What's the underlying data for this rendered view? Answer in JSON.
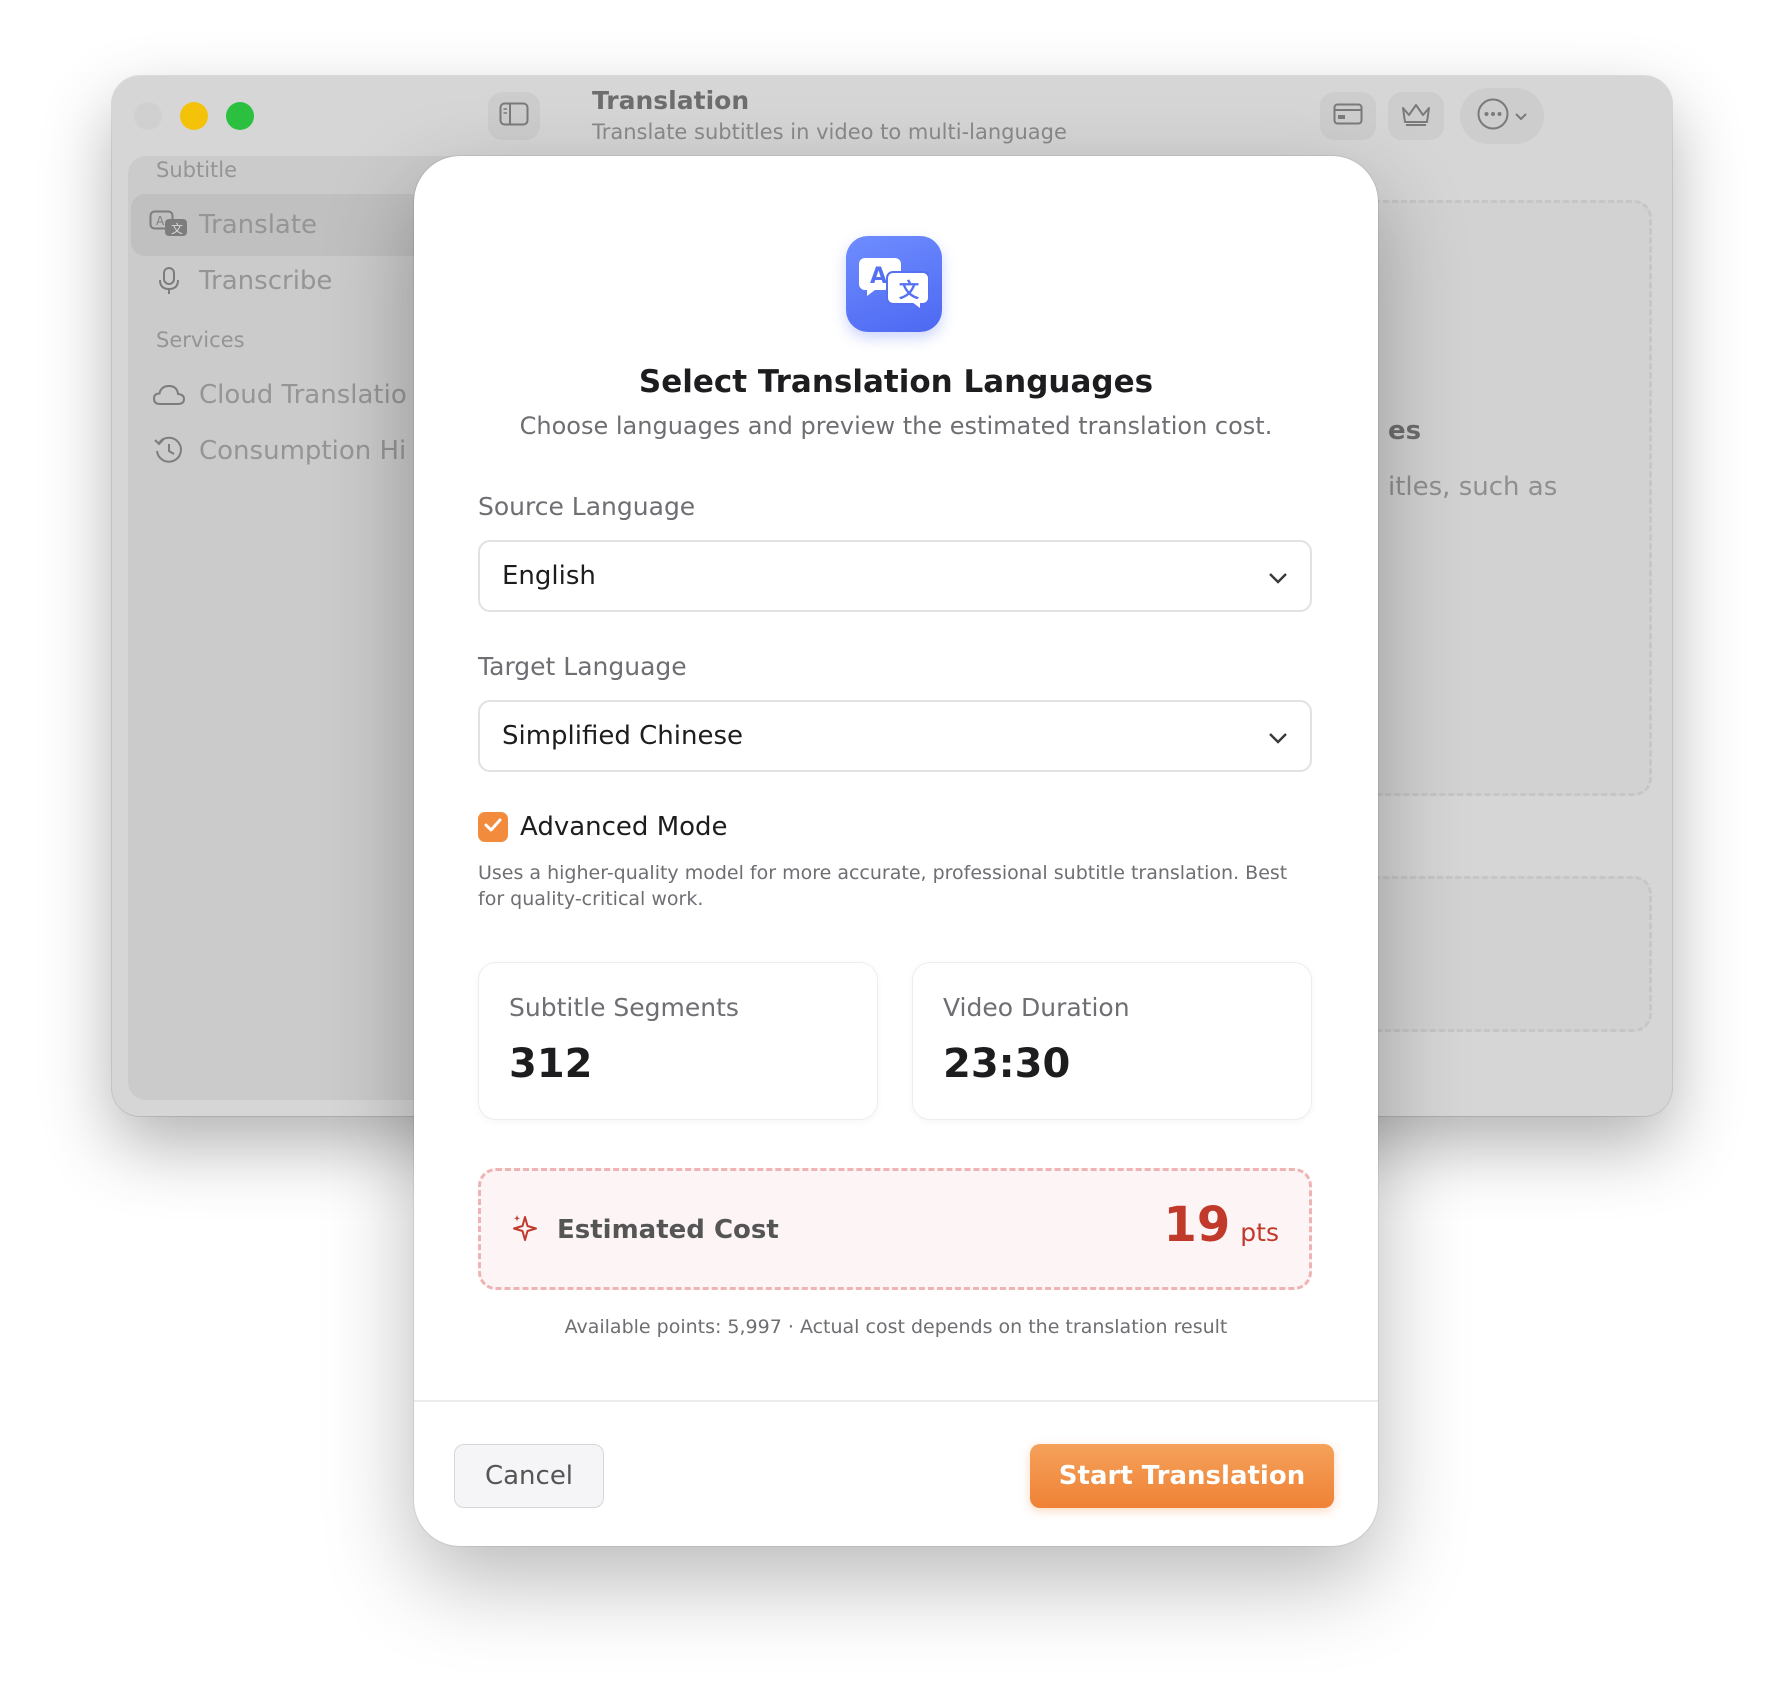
{
  "window": {
    "title": "Translation",
    "subtitle": "Translate subtitles in video to multi-language",
    "toolbar_icons": [
      "sidebar-toggle-icon",
      "card-icon",
      "crown-icon",
      "more-icon",
      "chevron-down-icon"
    ]
  },
  "sidebar": {
    "sections": [
      {
        "title": "Subtitle",
        "items": [
          {
            "label": "Translate",
            "icon": "translate-icon",
            "active": true
          },
          {
            "label": "Transcribe",
            "icon": "microphone-icon",
            "active": false
          }
        ]
      },
      {
        "title": "Services",
        "items": [
          {
            "label": "Cloud Translatio",
            "icon": "cloud-icon",
            "active": false
          },
          {
            "label": "Consumption Hi",
            "icon": "history-icon",
            "active": false
          }
        ]
      }
    ]
  },
  "background": {
    "heading_fragment": "es",
    "text_fragment": "itles, such as"
  },
  "dialog": {
    "icon": "translate-app-icon",
    "title": "Select Translation Languages",
    "subtitle": "Choose languages and preview the estimated translation cost.",
    "source": {
      "label": "Source Language",
      "value": "English"
    },
    "target": {
      "label": "Target Language",
      "value": "Simplified Chinese"
    },
    "advanced": {
      "label": "Advanced Mode",
      "checked": true,
      "description": "Uses a higher-quality model for more accurate, professional subtitle translation. Best for quality-critical work."
    },
    "stats": [
      {
        "label": "Subtitle Segments",
        "value": "312"
      },
      {
        "label": "Video Duration",
        "value": "23:30"
      }
    ],
    "cost": {
      "label": "Estimated Cost",
      "value": "19",
      "unit": "pts"
    },
    "note": "Available points: 5,997 · Actual cost depends on the translation result",
    "buttons": {
      "cancel": "Cancel",
      "start": "Start Translation"
    }
  },
  "colors": {
    "accent": "#f28b3b",
    "cost_red": "#c0392b",
    "app_icon_blue": "#5a75f5"
  }
}
